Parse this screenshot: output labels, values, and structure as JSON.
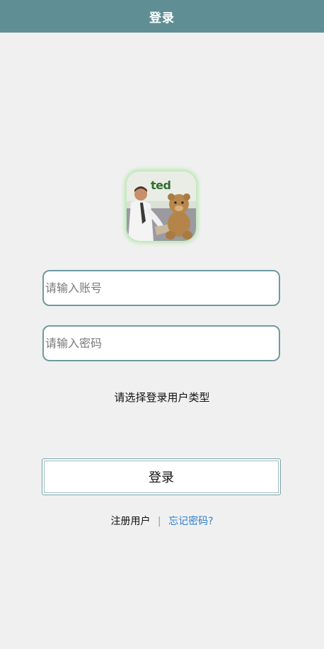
{
  "header": {
    "title": "登录"
  },
  "logo": {
    "text": "ted"
  },
  "form": {
    "account_placeholder": "请输入账号",
    "password_placeholder": "请输入密码",
    "user_type_label": "请选择登录用户类型",
    "login_label": "登录"
  },
  "links": {
    "register": "注册用户",
    "separator": "|",
    "forgot": "忘记密码?"
  }
}
